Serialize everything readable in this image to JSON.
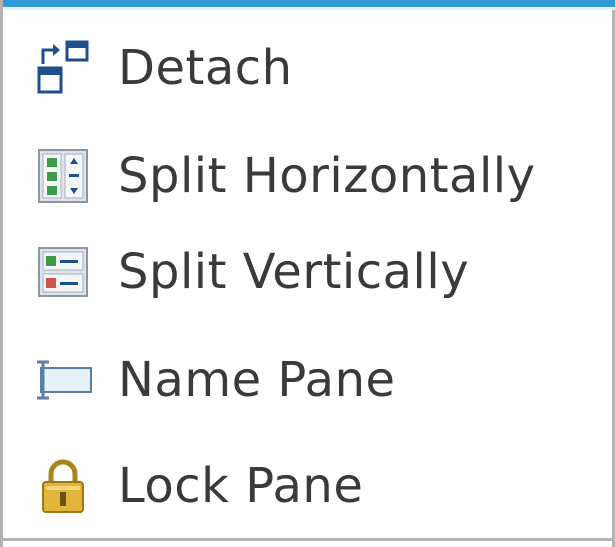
{
  "menu": {
    "items": [
      {
        "label": "Detach",
        "icon": "detach-icon"
      },
      {
        "label": "Split Horizontally",
        "icon": "split-horizontal-icon"
      },
      {
        "label": "Split Vertically",
        "icon": "split-vertical-icon"
      },
      {
        "label": "Name Pane",
        "icon": "name-pane-icon"
      },
      {
        "label": "Lock Pane",
        "icon": "lock-icon"
      }
    ]
  },
  "colors": {
    "accent": "#2f9ad6",
    "text": "#3a3a3a",
    "border": "#b4b4b4",
    "icon_blue": "#1f4e8c",
    "icon_green": "#3c9a4a",
    "icon_red": "#d0524a",
    "lock_gold": "#d9a326"
  }
}
